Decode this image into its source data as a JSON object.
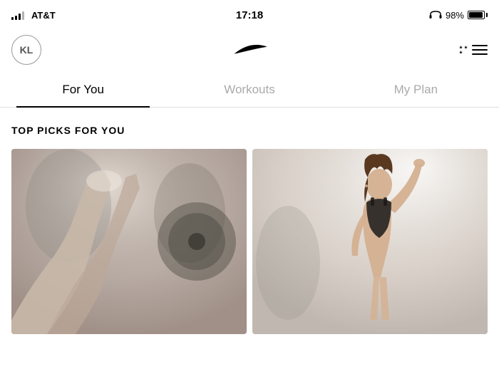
{
  "statusBar": {
    "carrier": "AT&T",
    "time": "17:18",
    "batteryPercent": "98%",
    "batteryLevel": 95
  },
  "header": {
    "avatarInitials": "KL",
    "logoAlt": "Nike Swoosh"
  },
  "tabs": [
    {
      "id": "for-you",
      "label": "For You",
      "active": true
    },
    {
      "id": "workouts",
      "label": "Workouts",
      "active": false
    },
    {
      "id": "my-plan",
      "label": "My Plan",
      "active": false
    }
  ],
  "content": {
    "sectionTitle": "TOP PICKS FOR YOU",
    "cards": [
      {
        "id": "card-1",
        "alt": "Workout card 1 - gym weights"
      },
      {
        "id": "card-2",
        "alt": "Workout card 2 - woman exercising"
      }
    ]
  }
}
